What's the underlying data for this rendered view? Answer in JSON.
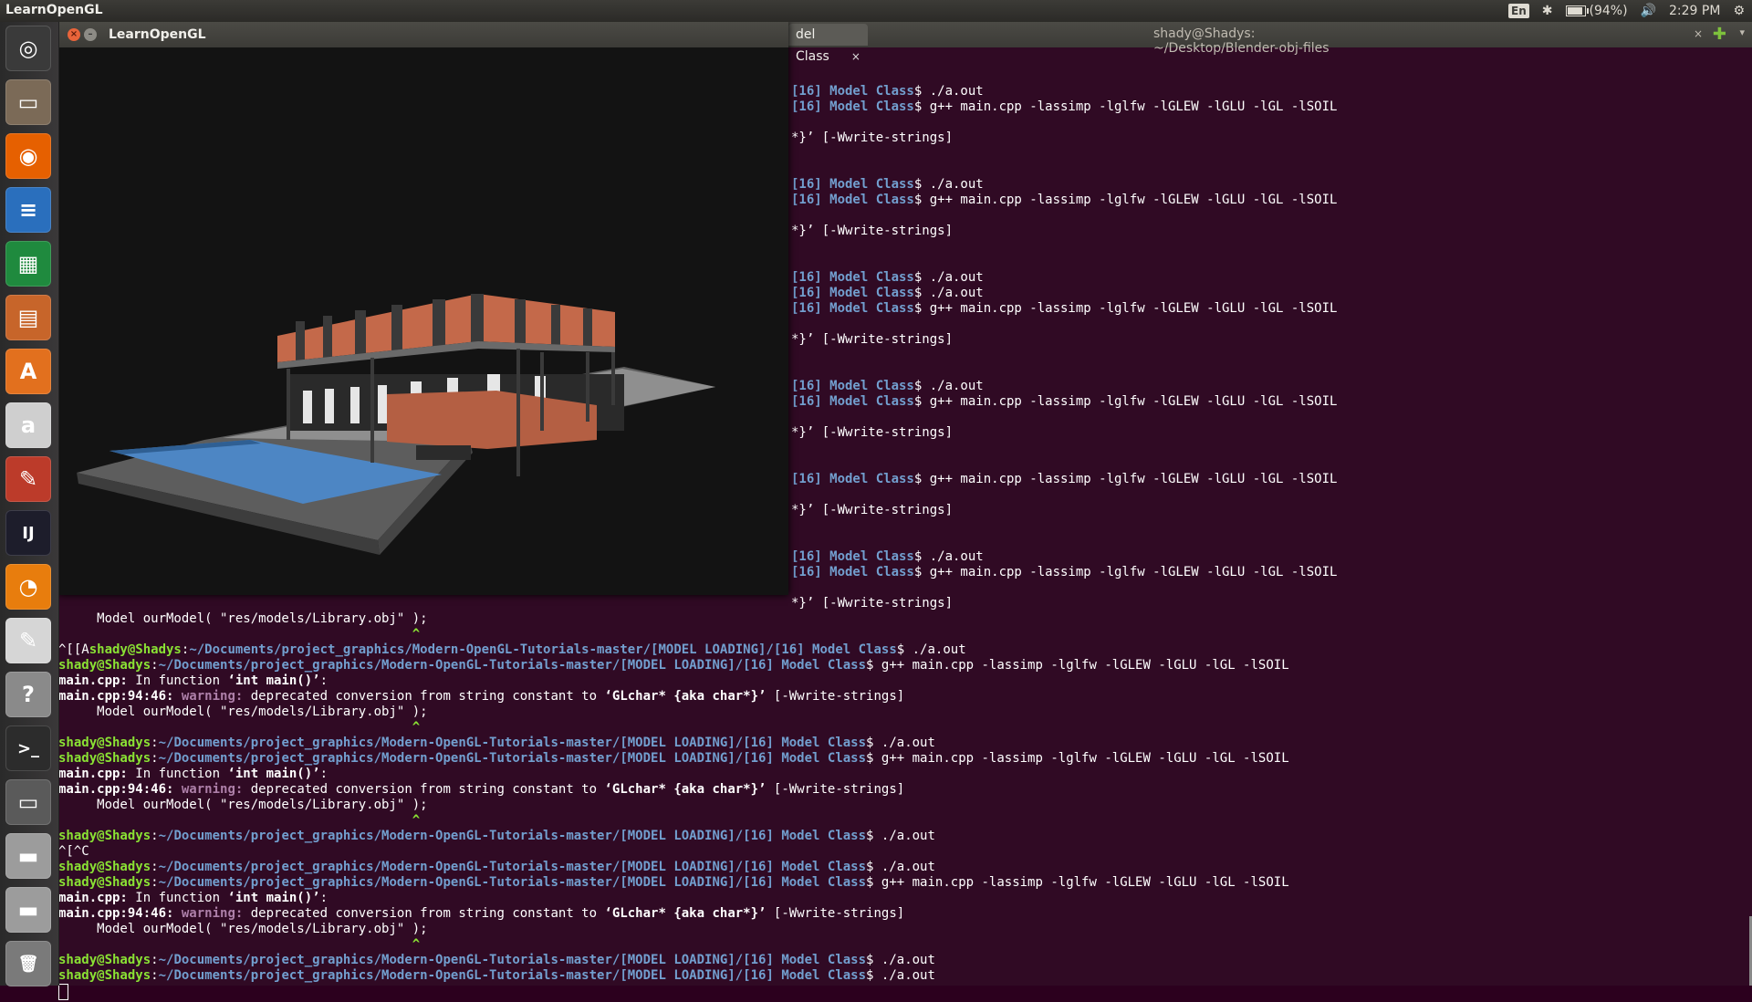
{
  "top_panel": {
    "app_title": "LearnOpenGL",
    "keyboard": "En",
    "battery": "(94%)",
    "battery_level_percent": 94,
    "time": "2:29 PM"
  },
  "launcher": {
    "items": [
      {
        "name": "ubuntu-dash-icon",
        "color": "#3a3a3a",
        "glyph": "◎"
      },
      {
        "name": "files-icon",
        "color": "#7b6a57",
        "glyph": "▭"
      },
      {
        "name": "firefox-icon",
        "color": "#e66000",
        "glyph": "◉"
      },
      {
        "name": "writer-icon",
        "color": "#2a6fbd",
        "glyph": "≡"
      },
      {
        "name": "calc-icon",
        "color": "#1f8a3e",
        "glyph": "▦"
      },
      {
        "name": "impress-icon",
        "color": "#c7652a",
        "glyph": "▤"
      },
      {
        "name": "software-center-icon",
        "color": "#e2701e",
        "glyph": "A"
      },
      {
        "name": "amazon-icon",
        "color": "#cfcfcf",
        "glyph": "a"
      },
      {
        "name": "system-settings-icon",
        "color": "#bc3b2a",
        "glyph": "✎"
      },
      {
        "name": "intellij-icon",
        "color": "#1d1d2b",
        "glyph": "IJ"
      },
      {
        "name": "blender-icon",
        "color": "#e87d0d",
        "glyph": "◔"
      },
      {
        "name": "text-editor-icon",
        "color": "#d6d6d6",
        "glyph": "✎"
      },
      {
        "name": "help-icon",
        "color": "#8a8a8a",
        "glyph": "?"
      },
      {
        "name": "terminal-icon",
        "color": "#2c2c2c",
        "glyph": ">_"
      },
      {
        "name": "workspace-switcher-icon",
        "color": "#5a5a5a",
        "glyph": "▭"
      },
      {
        "name": "drive-icon",
        "color": "#9c9c9c",
        "glyph": "▬"
      },
      {
        "name": "drive-icon-2",
        "color": "#9c9c9c",
        "glyph": "▬"
      },
      {
        "name": "trash-icon",
        "color": "#7a7a7a",
        "glyph": "🗑"
      }
    ]
  },
  "terminal": {
    "window_title": "shady@Shadys: ~/Desktop/Blender-obj-files",
    "tabs": [
      {
        "label": "del Class",
        "close": "×"
      }
    ],
    "new_tab": "✚",
    "lines": [
      [
        {
          "t": "[16] Model Class",
          "c": "pp"
        },
        {
          "t": "$ ./a.out"
        }
      ],
      [
        {
          "t": "[16] Model Class",
          "c": "pp"
        },
        {
          "t": "$ g++ main.cpp -lassimp -lglfw -lGLEW -lGLU -lGL -lSOIL"
        }
      ],
      [
        {
          "t": ""
        }
      ],
      [
        {
          "t": "*}’ [-Wwrite-strings]"
        }
      ],
      [
        {
          "t": ""
        }
      ],
      [
        {
          "t": ""
        }
      ],
      [
        {
          "t": "[16] Model Class",
          "c": "pp"
        },
        {
          "t": "$ ./a.out"
        }
      ],
      [
        {
          "t": "[16] Model Class",
          "c": "pp"
        },
        {
          "t": "$ g++ main.cpp -lassimp -lglfw -lGLEW -lGLU -lGL -lSOIL"
        }
      ],
      [
        {
          "t": ""
        }
      ],
      [
        {
          "t": "*}’ [-Wwrite-strings]"
        }
      ],
      [
        {
          "t": ""
        }
      ],
      [
        {
          "t": ""
        }
      ],
      [
        {
          "t": "[16] Model Class",
          "c": "pp"
        },
        {
          "t": "$ ./a.out"
        }
      ],
      [
        {
          "t": "[16] Model Class",
          "c": "pp"
        },
        {
          "t": "$ ./a.out"
        }
      ],
      [
        {
          "t": "[16] Model Class",
          "c": "pp"
        },
        {
          "t": "$ g++ main.cpp -lassimp -lglfw -lGLEW -lGLU -lGL -lSOIL"
        }
      ],
      [
        {
          "t": ""
        }
      ],
      [
        {
          "t": "*}’ [-Wwrite-strings]"
        }
      ],
      [
        {
          "t": ""
        }
      ],
      [
        {
          "t": ""
        }
      ],
      [
        {
          "t": "[16] Model Class",
          "c": "pp"
        },
        {
          "t": "$ ./a.out"
        }
      ],
      [
        {
          "t": "[16] Model Class",
          "c": "pp"
        },
        {
          "t": "$ g++ main.cpp -lassimp -lglfw -lGLEW -lGLU -lGL -lSOIL"
        }
      ],
      [
        {
          "t": ""
        }
      ],
      [
        {
          "t": "*}’ [-Wwrite-strings]"
        }
      ],
      [
        {
          "t": ""
        }
      ],
      [
        {
          "t": ""
        }
      ],
      [
        {
          "t": "[16] Model Class",
          "c": "pp"
        },
        {
          "t": "$ g++ main.cpp -lassimp -lglfw -lGLEW -lGLU -lGL -lSOIL"
        }
      ],
      [
        {
          "t": ""
        }
      ],
      [
        {
          "t": "*}’ [-Wwrite-strings]"
        }
      ],
      [
        {
          "t": ""
        }
      ],
      [
        {
          "t": ""
        }
      ],
      [
        {
          "t": "[16] Model Class",
          "c": "pp"
        },
        {
          "t": "$ ./a.out"
        }
      ],
      [
        {
          "t": "[16] Model Class",
          "c": "pp"
        },
        {
          "t": "$ g++ main.cpp -lassimp -lglfw -lGLEW -lGLU -lGL -lSOIL"
        }
      ],
      [
        {
          "t": ""
        }
      ],
      [
        {
          "t": "*}’ [-Wwrite-strings]"
        }
      ],
      [
        {
          "t": "     Model ourModel( \"res/models/Library.obj\" );"
        }
      ],
      [
        {
          "t": "                                              ^",
          "c": "caret"
        }
      ],
      [
        {
          "t": "^[[A"
        },
        {
          "t": "shady@Shadys",
          "c": "pu"
        },
        {
          "t": ":"
        },
        {
          "t": "~/Documents/project_graphics/Modern-OpenGL-Tutorials-master/[MODEL LOADING]/[16] Model Class",
          "c": "pp"
        },
        {
          "t": "$ ./a.out"
        }
      ],
      [
        {
          "t": "shady@Shadys",
          "c": "pu"
        },
        {
          "t": ":"
        },
        {
          "t": "~/Documents/project_graphics/Modern-OpenGL-Tutorials-master/[MODEL LOADING]/[16] Model Class",
          "c": "pp"
        },
        {
          "t": "$ g++ main.cpp -lassimp -lglfw -lGLEW -lGLU -lGL -lSOIL"
        }
      ],
      [
        {
          "t": "main.cpp:",
          "c": "pb"
        },
        {
          "t": " In function "
        },
        {
          "t": "‘int main()’",
          "c": "pb"
        },
        {
          "t": ":"
        }
      ],
      [
        {
          "t": "main.cpp:94:46:",
          "c": "pb"
        },
        {
          "t": " "
        },
        {
          "t": "warning:",
          "c": "pw"
        },
        {
          "t": " deprecated conversion from string constant to "
        },
        {
          "t": "‘GLchar* {aka char*}’",
          "c": "pb"
        },
        {
          "t": " [-Wwrite-strings]"
        }
      ],
      [
        {
          "t": "     Model ourModel( \"res/models/Library.obj\" );"
        }
      ],
      [
        {
          "t": "                                              ^",
          "c": "caret"
        }
      ],
      [
        {
          "t": "shady@Shadys",
          "c": "pu"
        },
        {
          "t": ":"
        },
        {
          "t": "~/Documents/project_graphics/Modern-OpenGL-Tutorials-master/[MODEL LOADING]/[16] Model Class",
          "c": "pp"
        },
        {
          "t": "$ ./a.out"
        }
      ],
      [
        {
          "t": "shady@Shadys",
          "c": "pu"
        },
        {
          "t": ":"
        },
        {
          "t": "~/Documents/project_graphics/Modern-OpenGL-Tutorials-master/[MODEL LOADING]/[16] Model Class",
          "c": "pp"
        },
        {
          "t": "$ g++ main.cpp -lassimp -lglfw -lGLEW -lGLU -lGL -lSOIL"
        }
      ],
      [
        {
          "t": "main.cpp:",
          "c": "pb"
        },
        {
          "t": " In function "
        },
        {
          "t": "‘int main()’",
          "c": "pb"
        },
        {
          "t": ":"
        }
      ],
      [
        {
          "t": "main.cpp:94:46:",
          "c": "pb"
        },
        {
          "t": " "
        },
        {
          "t": "warning:",
          "c": "pw"
        },
        {
          "t": " deprecated conversion from string constant to "
        },
        {
          "t": "‘GLchar* {aka char*}’",
          "c": "pb"
        },
        {
          "t": " [-Wwrite-strings]"
        }
      ],
      [
        {
          "t": "     Model ourModel( \"res/models/Library.obj\" );"
        }
      ],
      [
        {
          "t": "                                              ^",
          "c": "caret"
        }
      ],
      [
        {
          "t": "shady@Shadys",
          "c": "pu"
        },
        {
          "t": ":"
        },
        {
          "t": "~/Documents/project_graphics/Modern-OpenGL-Tutorials-master/[MODEL LOADING]/[16] Model Class",
          "c": "pp"
        },
        {
          "t": "$ ./a.out"
        }
      ],
      [
        {
          "t": "^[^C"
        }
      ],
      [
        {
          "t": "shady@Shadys",
          "c": "pu"
        },
        {
          "t": ":"
        },
        {
          "t": "~/Documents/project_graphics/Modern-OpenGL-Tutorials-master/[MODEL LOADING]/[16] Model Class",
          "c": "pp"
        },
        {
          "t": "$ ./a.out"
        }
      ],
      [
        {
          "t": "shady@Shadys",
          "c": "pu"
        },
        {
          "t": ":"
        },
        {
          "t": "~/Documents/project_graphics/Modern-OpenGL-Tutorials-master/[MODEL LOADING]/[16] Model Class",
          "c": "pp"
        },
        {
          "t": "$ g++ main.cpp -lassimp -lglfw -lGLEW -lGLU -lGL -lSOIL"
        }
      ],
      [
        {
          "t": "main.cpp:",
          "c": "pb"
        },
        {
          "t": " In function "
        },
        {
          "t": "‘int main()’",
          "c": "pb"
        },
        {
          "t": ":"
        }
      ],
      [
        {
          "t": "main.cpp:94:46:",
          "c": "pb"
        },
        {
          "t": " "
        },
        {
          "t": "warning:",
          "c": "pw"
        },
        {
          "t": " deprecated conversion from string constant to "
        },
        {
          "t": "‘GLchar* {aka char*}’",
          "c": "pb"
        },
        {
          "t": " [-Wwrite-strings]"
        }
      ],
      [
        {
          "t": "     Model ourModel( \"res/models/Library.obj\" );"
        }
      ],
      [
        {
          "t": "                                              ^",
          "c": "caret"
        }
      ],
      [
        {
          "t": "shady@Shadys",
          "c": "pu"
        },
        {
          "t": ":"
        },
        {
          "t": "~/Documents/project_graphics/Modern-OpenGL-Tutorials-master/[MODEL LOADING]/[16] Model Class",
          "c": "pp"
        },
        {
          "t": "$ ./a.out"
        }
      ],
      [
        {
          "t": "shady@Shadys",
          "c": "pu"
        },
        {
          "t": ":"
        },
        {
          "t": "~/Documents/project_graphics/Modern-OpenGL-Tutorials-master/[MODEL LOADING]/[16] Model Class",
          "c": "pp"
        },
        {
          "t": "$ ./a.out"
        }
      ],
      [
        {
          "t": "",
          "cursor": true
        }
      ]
    ]
  },
  "gl_window": {
    "title": "LearnOpenGL",
    "close": "×",
    "minimize": "–"
  }
}
